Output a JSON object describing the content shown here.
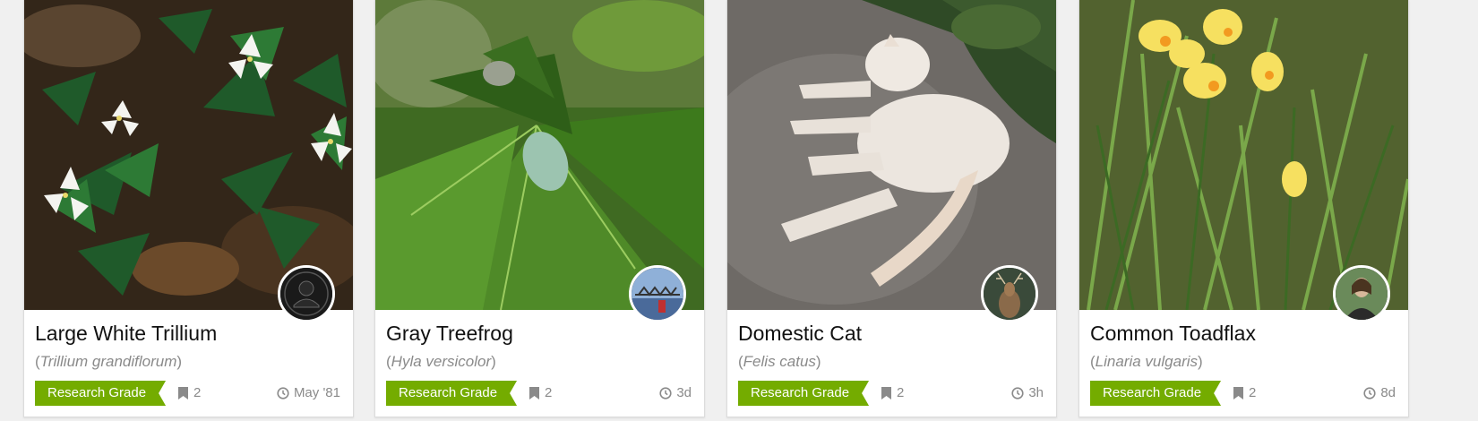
{
  "colors": {
    "research_grade": "#74ac00",
    "muted_text": "#8a8a8a",
    "title_text": "#111111",
    "card_bg": "#ffffff",
    "page_bg": "#f0f0f0"
  },
  "observations": [
    {
      "common_name": "Large White Trillium",
      "scientific_name": "Trillium grandiflorum",
      "quality_grade": "Research Grade",
      "identifications": "2",
      "time_ago": "May '81",
      "photo_subject": "white trillium flowers on forest floor",
      "avatar_icon": "default-user-silhouette-icon"
    },
    {
      "common_name": "Gray Treefrog",
      "scientific_name": "Hyla versicolor",
      "quality_grade": "Research Grade",
      "identifications": "2",
      "time_ago": "3d",
      "photo_subject": "gray treefrogs on maple leaves",
      "avatar_icon": "bridge-photo-avatar"
    },
    {
      "common_name": "Domestic Cat",
      "scientific_name": "Felis catus",
      "quality_grade": "Research Grade",
      "identifications": "2",
      "time_ago": "3h",
      "photo_subject": "white cat lying on dirt",
      "avatar_icon": "deer-photo-avatar"
    },
    {
      "common_name": "Common Toadflax",
      "scientific_name": "Linaria vulgaris",
      "quality_grade": "Research Grade",
      "identifications": "2",
      "time_ago": "8d",
      "photo_subject": "yellow toadflax flowers among grass",
      "avatar_icon": "person-photo-avatar"
    }
  ]
}
